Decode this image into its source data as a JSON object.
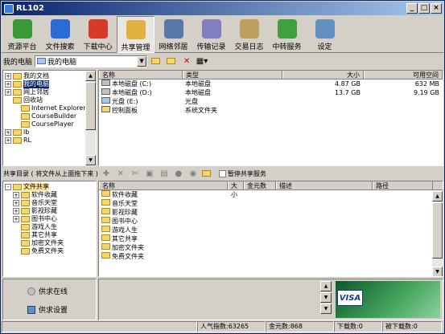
{
  "title": "RL102",
  "toolbar": [
    {
      "label": "资源平台",
      "icon": "resource-platform-icon",
      "color": "#3a9a3a"
    },
    {
      "label": "文件搜索",
      "icon": "file-search-icon",
      "color": "#2b6bd6"
    },
    {
      "label": "下载中心",
      "icon": "download-center-icon",
      "color": "#d63a2b"
    },
    {
      "label": "共享管理",
      "icon": "share-manage-icon",
      "color": "#e0b040"
    },
    {
      "label": "网络邻居",
      "icon": "network-neighbor-icon",
      "color": "#5a78a8"
    },
    {
      "label": "传输记录",
      "icon": "transfer-log-icon",
      "color": "#8080c0"
    },
    {
      "label": "交易日志",
      "icon": "trade-log-icon",
      "color": "#c0a060"
    },
    {
      "label": "中转服务",
      "icon": "relay-service-icon",
      "color": "#40a040"
    },
    {
      "label": "设定",
      "icon": "settings-icon",
      "color": "#6090c0"
    }
  ],
  "address": {
    "label": "我的电脑",
    "value": "我的电脑"
  },
  "tree": [
    {
      "label": "我的文档",
      "exp": "+",
      "indent": 0
    },
    {
      "label": "我的电脑",
      "exp": "+",
      "indent": 0
    },
    {
      "label": "网上邻居",
      "exp": "+",
      "indent": 0
    },
    {
      "label": "回收站",
      "exp": "",
      "indent": 0
    },
    {
      "label": "Internet Explorer",
      "exp": "",
      "indent": 1
    },
    {
      "label": "CourseBuilder",
      "exp": "",
      "indent": 1
    },
    {
      "label": "CoursePlayer",
      "exp": "",
      "indent": 1
    },
    {
      "label": "lb",
      "exp": "+",
      "indent": 0
    },
    {
      "label": "RL",
      "exp": "+",
      "indent": 0
    }
  ],
  "files": {
    "headers": [
      "名称",
      "类型",
      "大小",
      "可用空间"
    ],
    "rows": [
      [
        "本地磁盘 (C:)",
        "本地磁盘",
        "4.87 GB",
        "632 MB"
      ],
      [
        "本地磁盘 (D:)",
        "本地磁盘",
        "13.7 GB",
        "9.19 GB"
      ],
      [
        "光盘 (E:)",
        "光盘",
        "",
        ""
      ],
      [
        "控制面板",
        "系统文件夹",
        "",
        ""
      ]
    ]
  },
  "share_label": "共享目录 ( 将文件从上面拖下来 )",
  "pause_label": "暂停共享服务",
  "share_tree": [
    {
      "label": "文件共享",
      "exp": "-",
      "indent": 0
    },
    {
      "label": "软件收藏",
      "exp": "+",
      "indent": 1
    },
    {
      "label": "音乐天堂",
      "exp": "+",
      "indent": 1
    },
    {
      "label": "影视珍藏",
      "exp": "+",
      "indent": 1
    },
    {
      "label": "图书中心",
      "exp": "+",
      "indent": 1
    },
    {
      "label": "游戏人生",
      "exp": "",
      "indent": 1
    },
    {
      "label": "其它共享",
      "exp": "",
      "indent": 1
    },
    {
      "label": "加密文件夹",
      "exp": "",
      "indent": 1
    },
    {
      "label": "免费文件夹",
      "exp": "",
      "indent": 1
    }
  ],
  "share_files": {
    "headers": [
      "名称",
      "大小",
      "金元数",
      "描述",
      "路径"
    ],
    "rows": [
      "软件收藏",
      "音乐天堂",
      "影视珍藏",
      "图书中心",
      "游戏人生",
      "其它共享",
      "加密文件夹",
      "免费文件夹"
    ]
  },
  "bottom": {
    "online": "供求在线",
    "setting": "供求设置",
    "card": "VISA"
  },
  "status": [
    "",
    "人气指数:63265",
    "金元数:868",
    "下载数:0",
    "被下载数:0"
  ]
}
